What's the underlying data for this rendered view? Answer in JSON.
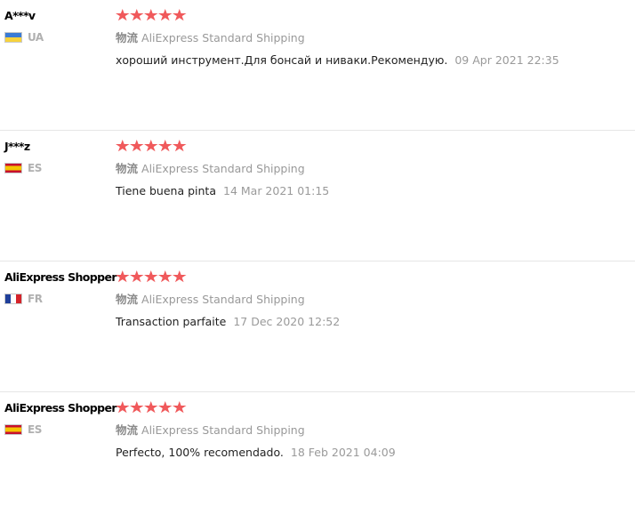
{
  "shipping_label": "物流",
  "reviews": [
    {
      "user": "A***v",
      "country": "UA",
      "flag": [
        "#3a7bd5",
        "#f7d23c"
      ],
      "stars": 5,
      "shipping": "AliExpress Standard Shipping",
      "text": "хороший инструмент.Для бонсай и ниваки.Рекомендую.",
      "date": "09 Apr 2021 22:35"
    },
    {
      "user": "J***z",
      "country": "ES",
      "flag": [
        "#c8102e",
        "#f5c400",
        "#c8102e"
      ],
      "stars": 5,
      "shipping": "AliExpress Standard Shipping",
      "text": "Tiene buena pinta",
      "date": "14 Mar 2021 01:15"
    },
    {
      "user": "AliExpress Shopper",
      "country": "FR",
      "flag": [
        "#1f3f9a",
        "#ffffff",
        "#d5232a"
      ],
      "stars": 5,
      "shipping": "AliExpress Standard Shipping",
      "text": "Transaction parfaite",
      "date": "17 Dec 2020 12:52"
    },
    {
      "user": "AliExpress Shopper",
      "country": "ES",
      "flag": [
        "#c8102e",
        "#f5c400",
        "#c8102e"
      ],
      "stars": 5,
      "shipping": "AliExpress Standard Shipping",
      "text": "Perfecto, 100% recomendado.",
      "date": "18 Feb 2021 04:09"
    }
  ],
  "colors": {
    "star": "#f0595b",
    "muted": "#999999"
  }
}
